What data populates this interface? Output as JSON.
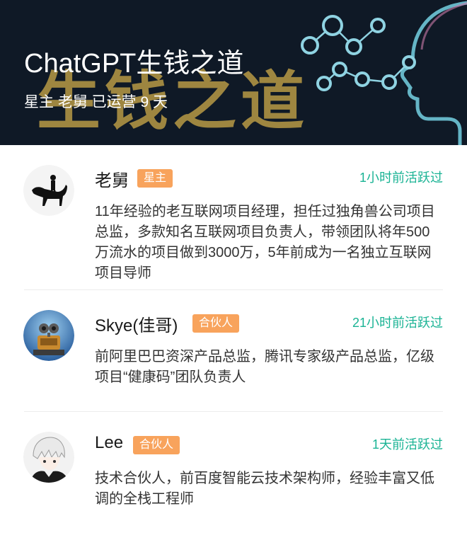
{
  "banner": {
    "title": "ChatGPT生钱之道",
    "background_text": "生钱之道",
    "subtitle": "星主 老舅 已运营 9 天",
    "colors": {
      "background": "#0f1926",
      "accent_gold": "#b89a45",
      "brain_glow": "#6fc6d8"
    }
  },
  "members": [
    {
      "name": "老舅",
      "badge": "星主",
      "active": "1小时前活跃过",
      "bio": "11年经验的老互联网项目经理，担任过独角兽公司项目总监，多款知名互联网项目负责人，带领团队将年500万流水的项目做到3000万，5年前成为一名独立互联网项目导师",
      "avatar_icon": "dog-and-person-avatar"
    },
    {
      "name": "Skye(佳哥)",
      "badge": "合伙人",
      "active": "21小时前活跃过",
      "bio": "前阿里巴巴资深产品总监，腾讯专家级产品总监，亿级项目“健康码”团队负责人",
      "avatar_icon": "robot-avatar"
    },
    {
      "name": "Lee",
      "badge": "合伙人",
      "active": "1天前活跃过",
      "bio": "技术合伙人，前百度智能云技术架构师，经验丰富又低调的全栈工程师",
      "avatar_icon": "anime-character-avatar"
    }
  ],
  "colors": {
    "badge": "#f8a35c",
    "active_text": "#1ab394",
    "name_text": "#1a1a1a",
    "bio_text": "#333333"
  }
}
